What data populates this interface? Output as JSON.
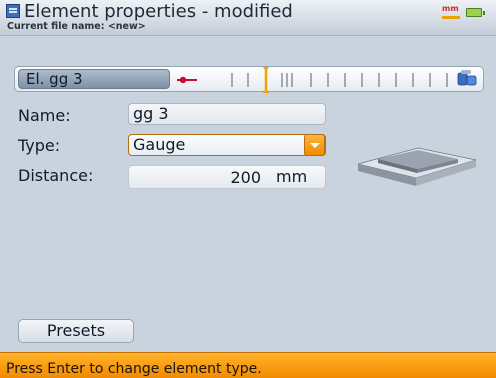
{
  "window": {
    "title": "Element properties - modified",
    "file_name": "Current file name: <new>",
    "units": "mm"
  },
  "element_selector": {
    "selected_label": "El. gg 3"
  },
  "form": {
    "name_label": "Name:",
    "name_value": "gg 3",
    "type_label": "Type:",
    "type_value": "Gauge",
    "distance_label": "Distance:",
    "distance_value": "200",
    "distance_unit": "mm"
  },
  "buttons": {
    "presets": "Presets"
  },
  "status": {
    "message": "Press Enter to change element type."
  },
  "colors": {
    "accent_orange": "#f28a00",
    "marker_red": "#c8102e",
    "selected_marker": "#f5a000",
    "battery_green": "#9ad34a"
  },
  "icons": {
    "window": "app-window-icon",
    "battery": "battery-icon",
    "coupling": "coupling-icon",
    "gauge": "gauge-illustration"
  }
}
